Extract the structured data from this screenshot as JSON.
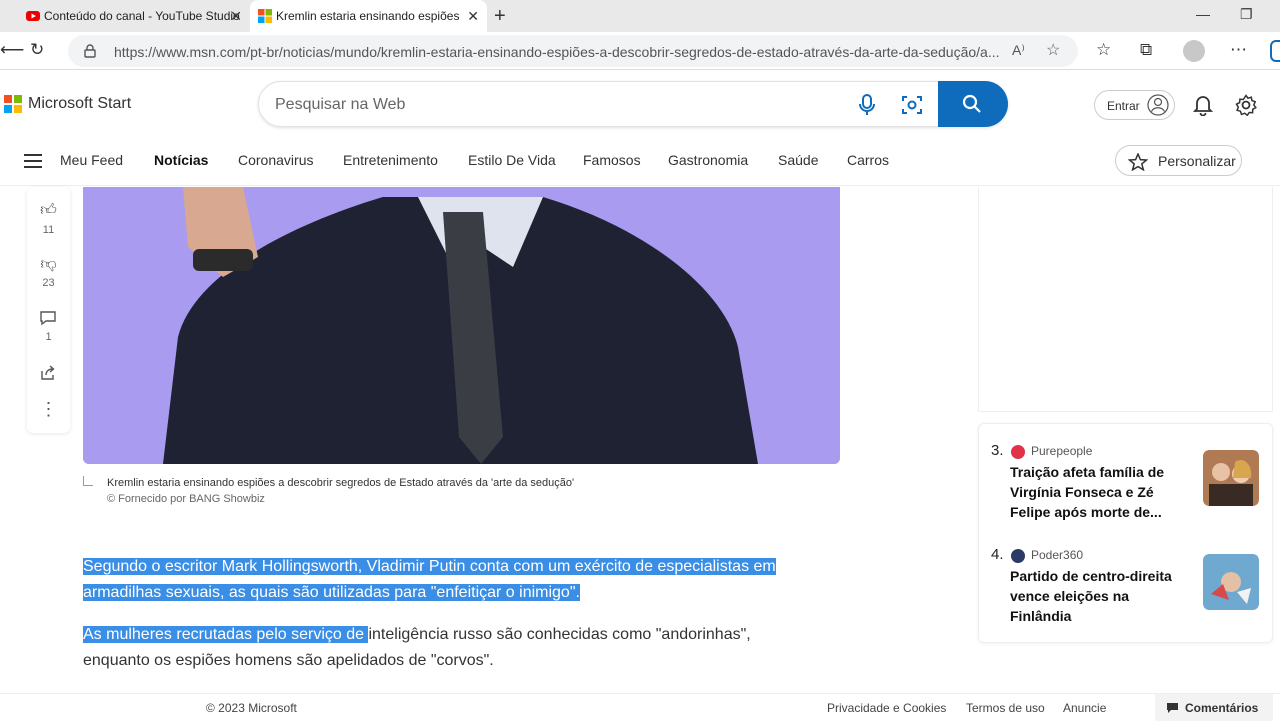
{
  "tabs": [
    {
      "title": "Conteúdo do canal - YouTube Studio",
      "active": false
    },
    {
      "title": "Kremlin estaria ensinando espiões",
      "active": true
    }
  ],
  "address_bar": {
    "url": "https://www.msn.com/pt-br/noticias/mundo/kremlin-estaria-ensinando-espiões-a-descobrir-segredos-de-estado-através-da-arte-da-sedução/a..."
  },
  "header": {
    "brand": "Microsoft Start",
    "search_placeholder": "Pesquisar na Web",
    "signin_label": "Entrar"
  },
  "nav": {
    "items": [
      "Meu Feed",
      "Notícias",
      "Coronavirus",
      "Entretenimento",
      "Estilo De Vida",
      "Famosos",
      "Gastronomia",
      "Saúde",
      "Carros"
    ],
    "active": "Notícias",
    "personalize_label": "Personalizar"
  },
  "rail": {
    "likes": "11",
    "dislikes": "23",
    "comments": "1"
  },
  "article": {
    "caption": "Kremlin estaria ensinando espiões a descobrir segredos de Estado através da 'arte da sedução'",
    "credit": "© Fornecido por BANG Showbiz",
    "para1_line1": "Segundo o escritor Mark Hollingsworth, Vladimir Putin conta com um exército de especialistas em",
    "para1_line2": "armadilhas sexuais, as quais são utilizadas para \"enfeitiçar o inimigo\".",
    "para2_highlight": "As mulheres recrutadas pelo serviço de ",
    "para2_rest": "inteligência russo são conhecidas como \"andorinhas\",",
    "para2_line2": "enquanto os espiões homens são apelidados de \"corvos\"."
  },
  "trending": [
    {
      "rank": "3.",
      "source": "Purepeople",
      "title": "Traição afeta família de Virgínia Fonseca e Zé Felipe após morte de...",
      "dot_color": "#e0334a"
    },
    {
      "rank": "4.",
      "source": "Poder360",
      "title": "Partido de centro-direita vence eleições na Finlândia",
      "dot_color": "#2b3a67"
    }
  ],
  "footer": {
    "copyright": "© 2023 Microsoft",
    "privacy": "Privacidade e Cookies",
    "terms": "Termos de uso",
    "advertise": "Anuncie",
    "comments_label": "Comentários"
  }
}
